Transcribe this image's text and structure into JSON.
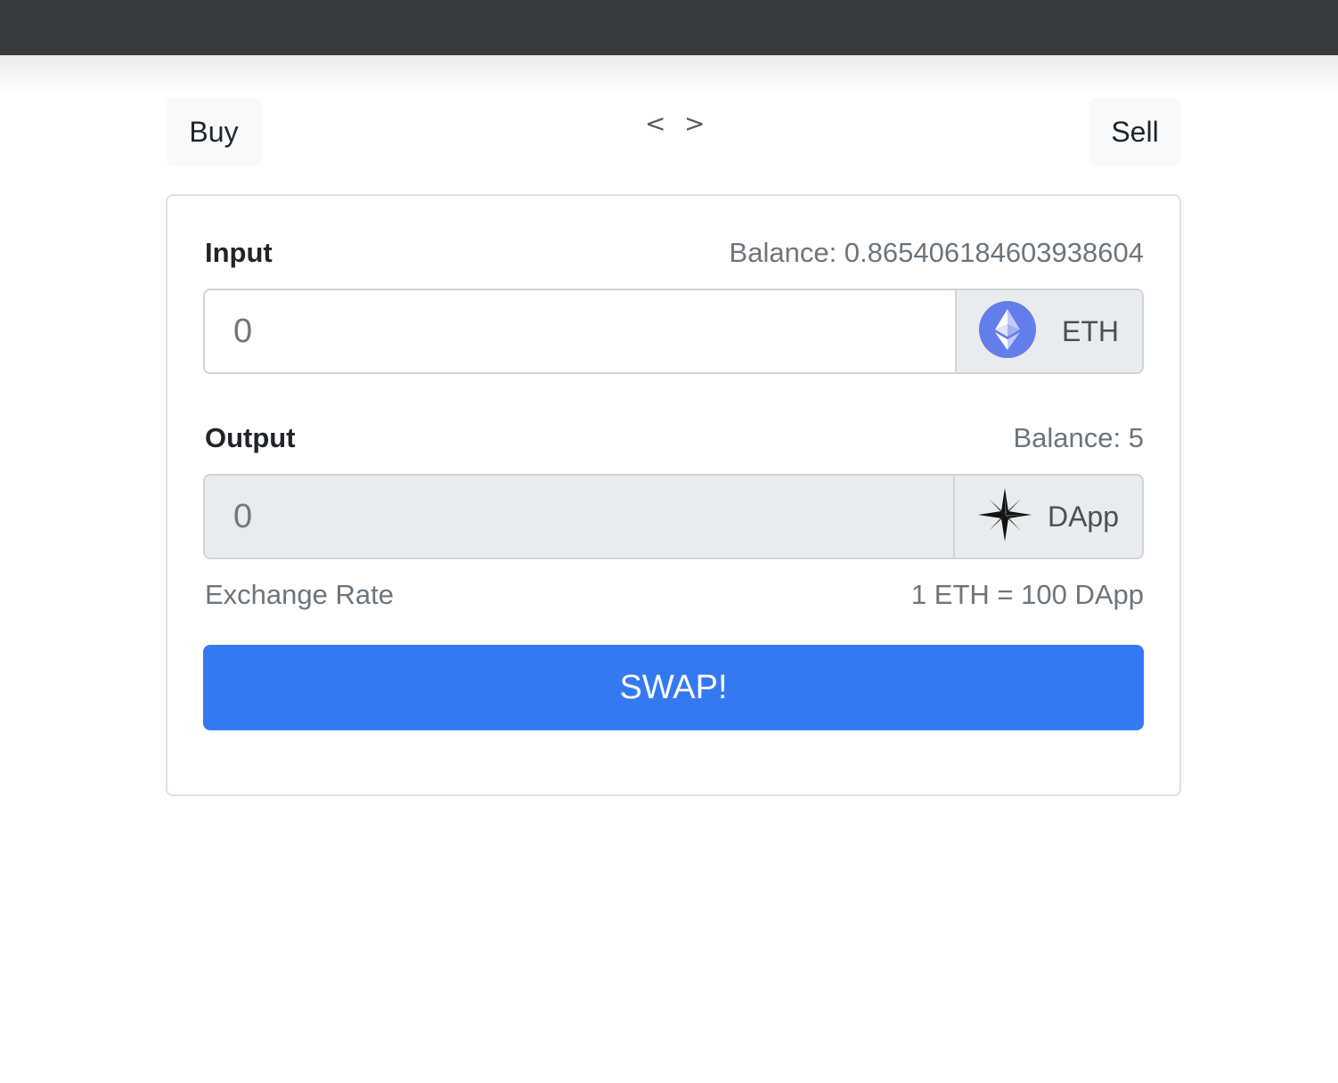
{
  "nav": {
    "buy_label": "Buy",
    "sell_label": "Sell",
    "prev_label": "<",
    "next_label": ">"
  },
  "input": {
    "label": "Input",
    "balance": "Balance: 0.865406184603938604",
    "placeholder": "0",
    "token": "ETH",
    "token_icon": "ethereum-icon"
  },
  "output": {
    "label": "Output",
    "balance": "Balance: 5",
    "placeholder": "0",
    "token": "DApp",
    "token_icon": "compass-star-icon"
  },
  "exchange": {
    "label": "Exchange Rate",
    "value": "1 ETH = 100 DApp"
  },
  "swap_label": "SWAP!",
  "colors": {
    "navbar": "#373b3f",
    "primary": "#3479f1",
    "eth": "#627eea"
  }
}
